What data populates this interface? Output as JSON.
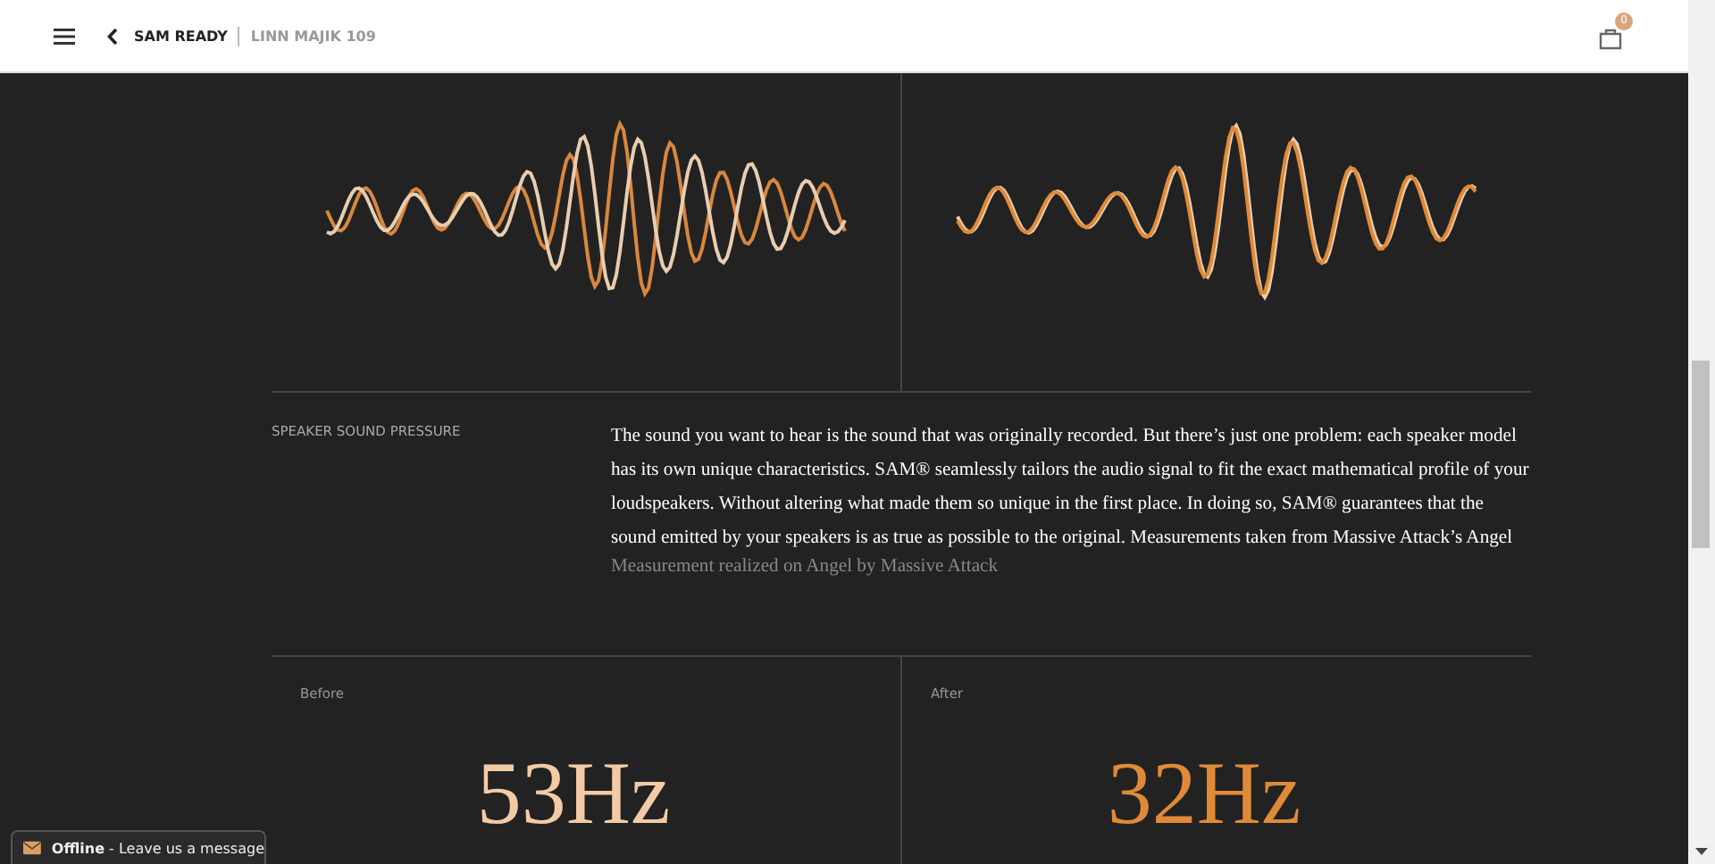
{
  "header": {
    "title": "SAM READY",
    "subtitle": "LINN MAJIK 109"
  },
  "cart": {
    "count": "0"
  },
  "section": {
    "label": "SPEAKER SOUND PRESSURE",
    "paragraph": "The sound you want to hear is the sound that was originally recorded. But there’s just one problem: each speaker model has its own unique characteristics. SAM® seamlessly tailors the audio signal to fit the exact mathematical profile of your loudspeakers. Without altering what made them so unique in the first place. In doing so, SAM® guarantees that the sound emitted by your speakers is as true as possible to the original. Measurements taken from Massive Attack’s Angel",
    "caption": "Measurement realized on Angel by Massive Attack"
  },
  "comparison": [
    {
      "label": "Before",
      "value": "53Hz",
      "kind": "before"
    },
    {
      "label": "After",
      "value": "32Hz",
      "kind": "after"
    }
  ],
  "chat": {
    "message": "**Offline** - Leave us a message"
  }
}
